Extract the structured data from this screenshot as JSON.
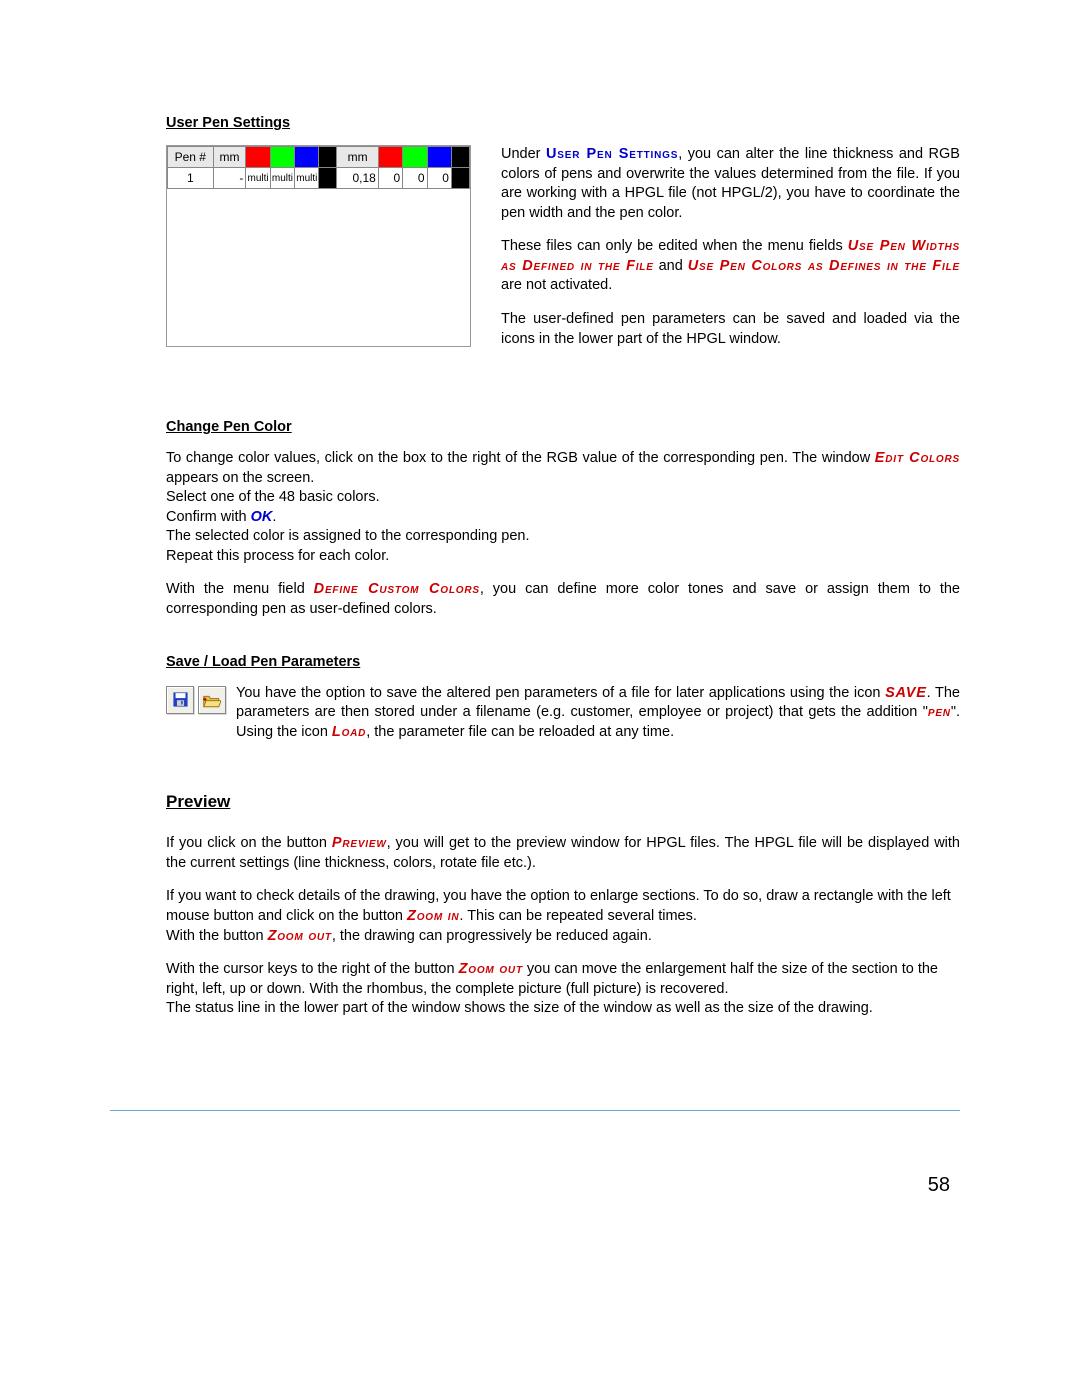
{
  "sections": {
    "userPenSettings": {
      "heading": "User Pen Settings",
      "table": {
        "headers": {
          "pen": "Pen #",
          "mm1": "mm",
          "mm2": "mm"
        },
        "row": {
          "pen": "1",
          "mm1": "-",
          "r1": "multi",
          "g1": "multi",
          "b1": "multi",
          "mm2": "0,18",
          "r2": "0",
          "g2": "0",
          "b2": "0"
        },
        "colors": {
          "h_r": "#ff0000",
          "h_g": "#00ff00",
          "h_b": "#0000ff",
          "h_sw": "#000000",
          "row_sw1": "#000000",
          "row_sw2": "#000000"
        }
      },
      "para1_pre": "Under ",
      "para1_scap": "User Pen Settings",
      "para1_post": ", you can alter the line thickness and RGB colors of pens and overwrite the values determined from the file. If you are working with a HPGL file (not HPGL/2), you have to coordinate the pen width and the pen color.",
      "para2_pre": "These files can only be edited when the menu fields ",
      "para2_red1": "Use Pen Widths as Defined in the File",
      "para2_mid": " and ",
      "para2_red2": "Use Pen Colors as Defines in the File",
      "para2_post": " are not activated.",
      "para3": "The user-defined pen parameters can be saved and loaded via the icons in the lower part of the HPGL window."
    },
    "changePenColor": {
      "heading": "Change Pen Color",
      "line1": "To change color values, click on the box to the right of the RGB value of the corresponding pen. The window ",
      "line1_red": "Edit Colors",
      "line1_post": " appears on the screen.",
      "line2": "Select one of the 48 basic colors.",
      "line3_pre": "Confirm with ",
      "line3_ok": "OK",
      "line3_post": ".",
      "line4": "The selected color is assigned to the corresponding pen.",
      "line5": "Repeat this process for each color.",
      "para2_pre": "With the menu field ",
      "para2_red": "Define Custom Colors",
      "para2_post": ", you can define more color tones and save or assign them to the corresponding pen as user-defined colors."
    },
    "saveLoad": {
      "heading": "Save / Load Pen Parameters",
      "text_pre": "You have the option to save the altered pen parameters of a file for later applications using the icon ",
      "text_save": "SAVE",
      "text_mid1": ". The parameters are then stored under a filename (e.g. customer, employee or project) that gets the addition \"",
      "text_pen": "pen",
      "text_mid2": "\". Using the icon ",
      "text_load": "Load",
      "text_post": ", the parameter file can be reloaded at any time."
    },
    "preview": {
      "heading": "Preview",
      "p1_pre": "If you click on the button ",
      "p1_red": "Preview",
      "p1_post": ", you will get to the preview window for HPGL files. The HPGL file will be displayed with the current settings (line thickness, colors, rotate file etc.).",
      "p2_pre": "If you want to check details of the drawing, you have the option to enlarge sections. To do so, draw a rectangle with the left mouse button and click on the button ",
      "p2_red": "Zoom in",
      "p2_mid": ". This can be repeated several times.",
      "p2b_pre": "With the button ",
      "p2b_red": "Zoom out",
      "p2b_post": ", the drawing can progressively be reduced again.",
      "p3_pre": "With the cursor keys to the right of the button ",
      "p3_red": "Zoom out",
      "p3_post": " you can move the enlargement half the size of the section to the right, left, up or down. With the rhombus, the complete picture (full picture) is recovered.",
      "p3b": "The status line in the lower part of the window shows the size of the window as well as the size of the drawing."
    }
  },
  "pageNumber": "58"
}
